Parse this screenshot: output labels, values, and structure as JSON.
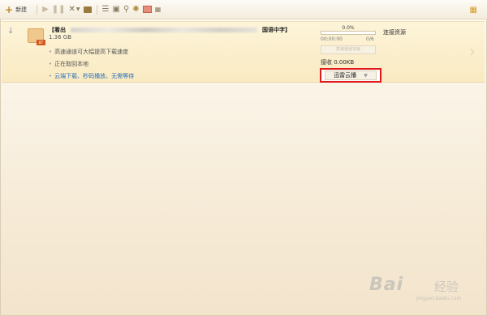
{
  "toolbar": {
    "new_label": "新建",
    "icons": [
      "plus-icon",
      "play-icon",
      "pause-icon",
      "delete-icon",
      "chevron-down-icon",
      "folder-icon",
      "list-icon",
      "properties-icon",
      "search-icon",
      "gear-icon",
      "gift-icon",
      "skin-icon",
      "grid-icon"
    ]
  },
  "task": {
    "title_prefix": "【看出",
    "title_suffix": "国语中字】",
    "size": "1.36 GB",
    "hints": [
      "高速通道可大幅提高下载速度",
      "正在取回本地",
      "云端下载、秒码播放、无需等待"
    ],
    "progress_percent": "0.0%",
    "progress_value": 0,
    "progress_size": "00:00:00",
    "progress_count": "0/6",
    "status_label": "连接资源",
    "accelerate_label": "高速通道加速",
    "speed": "接收 0.00KB",
    "cloud_play_label": "迅雷云播"
  },
  "watermark": {
    "brand": "Bai",
    "brand2": "经验",
    "url": "jingyan.baidu.com"
  }
}
